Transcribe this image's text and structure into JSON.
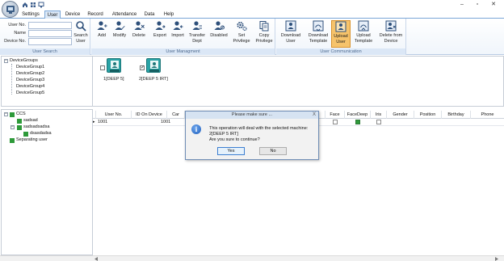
{
  "window": {
    "minimize": "–",
    "restore": "▫",
    "close": "✕"
  },
  "menu": {
    "tabs": [
      {
        "label": "Settings"
      },
      {
        "label": "User"
      },
      {
        "label": "Device"
      },
      {
        "label": "Record"
      },
      {
        "label": "Attendance"
      },
      {
        "label": "Data"
      },
      {
        "label": "Help"
      }
    ],
    "active": "User"
  },
  "ribbon": {
    "search": {
      "fields": [
        {
          "label": "User No.",
          "value": ""
        },
        {
          "label": "Name",
          "value": ""
        },
        {
          "label": "Device No.",
          "value": ""
        }
      ],
      "button": "Search\nUser",
      "group_label": "User Search"
    },
    "management": {
      "buttons": [
        "Add",
        "Modify",
        "Delete",
        "Export",
        "Import",
        "Transfer\nDept",
        "Disabled",
        "Set\nPrivilege",
        "Copy\nPrivilege"
      ],
      "group_label": "User Managment"
    },
    "communication": {
      "buttons": [
        "Download\nUser",
        "Download\nTemplate",
        "Upload\nUser",
        "Upload\nTemplate",
        "Delete from\nDevice"
      ],
      "active": "Upload\nUser",
      "group_label": "User Communication"
    }
  },
  "device_groups": {
    "root": "DeviceGroups",
    "items": [
      "DeviceGroup1",
      "DeviceGroup2",
      "DeviceGroup3",
      "DeviceGroup4",
      "DeviceGroup5"
    ]
  },
  "devices": [
    {
      "label": "1[DEEP 5]",
      "checked": false
    },
    {
      "label": "2[DEEP 5 IRT]",
      "checked": true
    }
  ],
  "dept_tree": {
    "items": [
      {
        "label": "CCS",
        "level": 0
      },
      {
        "label": "sadsad",
        "level": 1
      },
      {
        "label": "sadsadsadsa",
        "level": 1
      },
      {
        "label": "dsasdadsa",
        "level": 2
      },
      {
        "label": "Separating user",
        "level": 0
      }
    ]
  },
  "table": {
    "columns": [
      "User No.",
      "ID On Device",
      "Car",
      "",
      "Face",
      "FaceDeep",
      "Iris",
      "Gender",
      "Position",
      "Birthday",
      "Phone"
    ],
    "rows": [
      {
        "user_no": "1001",
        "id_on_device": "1001",
        "face": false,
        "facedeep": true,
        "iris": false
      }
    ]
  },
  "dialog": {
    "title": "Please make sure ...",
    "close": "X",
    "lines": [
      "This operation will deal with the selected machine:",
      "2[DEEP 5 IRT]",
      "Are you sure to continue?"
    ],
    "yes": "Yes",
    "no": "No"
  },
  "colors": {
    "accent": "#7aa6d6",
    "active_button": "#f6c36b",
    "device_icon": "#2aa3a6",
    "tree_node": "#2e9a3a"
  }
}
